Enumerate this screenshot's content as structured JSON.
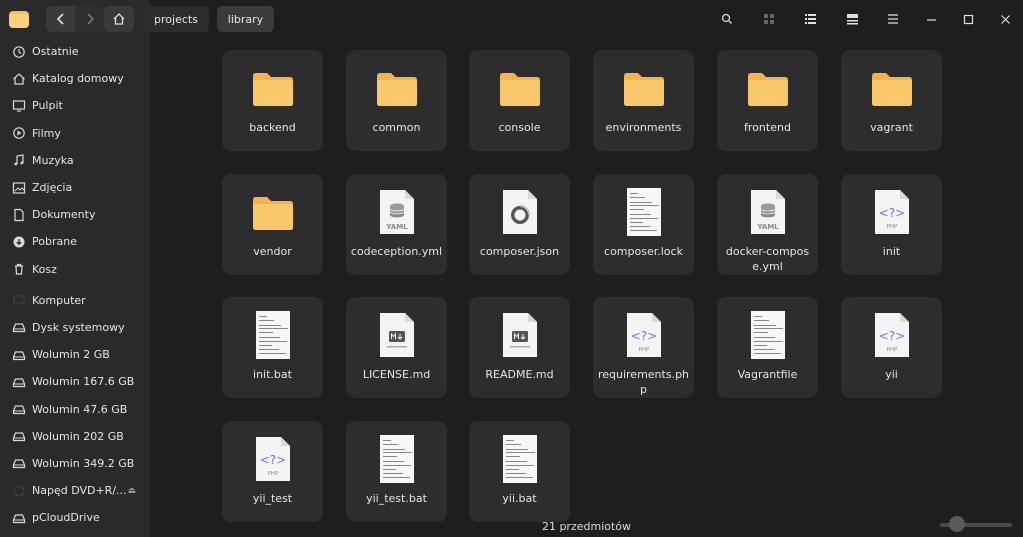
{
  "header": {
    "breadcrumbs": [
      "projects",
      "library"
    ]
  },
  "sidebar": {
    "places": [
      {
        "label": "Ostatnie",
        "icon": "clock-icon"
      },
      {
        "label": "Katalog domowy",
        "icon": "home-icon"
      },
      {
        "label": "Pulpit",
        "icon": "desktop-icon"
      },
      {
        "label": "Filmy",
        "icon": "video-icon"
      },
      {
        "label": "Muzyka",
        "icon": "music-icon"
      },
      {
        "label": "Zdjęcia",
        "icon": "image-icon"
      },
      {
        "label": "Dokumenty",
        "icon": "document-icon"
      },
      {
        "label": "Pobrane",
        "icon": "download-icon"
      },
      {
        "label": "Kosz",
        "icon": "trash-icon"
      }
    ],
    "devices": [
      {
        "label": "Komputer",
        "icon": "computer-icon"
      },
      {
        "label": "Dysk systemowy",
        "icon": "drive-icon"
      },
      {
        "label": "Wolumin 2 GB",
        "icon": "drive-icon"
      },
      {
        "label": "Wolumin 167.6 GB",
        "icon": "drive-icon"
      },
      {
        "label": "Wolumin 47.6 GB",
        "icon": "drive-icon"
      },
      {
        "label": "Wolumin 202 GB",
        "icon": "drive-icon"
      },
      {
        "label": "Wolumin 349.2 GB",
        "icon": "drive-icon"
      },
      {
        "label": "Napęd DVD+R/...",
        "icon": "optical-drive-icon"
      },
      {
        "label": "pCloudDrive",
        "icon": "cloud-drive-icon"
      }
    ]
  },
  "files": [
    {
      "name": "backend",
      "type": "folder"
    },
    {
      "name": "common",
      "type": "folder"
    },
    {
      "name": "console",
      "type": "folder"
    },
    {
      "name": "environments",
      "type": "folder"
    },
    {
      "name": "frontend",
      "type": "folder"
    },
    {
      "name": "vagrant",
      "type": "folder"
    },
    {
      "name": "vendor",
      "type": "folder"
    },
    {
      "name": "codeception.yml",
      "type": "yaml"
    },
    {
      "name": "composer.json",
      "type": "json"
    },
    {
      "name": "composer.lock",
      "type": "text"
    },
    {
      "name": "docker-compose.yml",
      "type": "yaml"
    },
    {
      "name": "init",
      "type": "php"
    },
    {
      "name": "init.bat",
      "type": "text"
    },
    {
      "name": "LICENSE.md",
      "type": "markdown"
    },
    {
      "name": "README.md",
      "type": "markdown"
    },
    {
      "name": "requirements.php",
      "type": "php"
    },
    {
      "name": "Vagrantfile",
      "type": "text"
    },
    {
      "name": "yii",
      "type": "php"
    },
    {
      "name": "yii_test",
      "type": "php"
    },
    {
      "name": "yii_test.bat",
      "type": "text"
    },
    {
      "name": "yii.bat",
      "type": "text"
    }
  ],
  "status": {
    "item_count": "21 przedmiotów"
  },
  "colors": {
    "folder": "#f9c86a",
    "folder_tab": "#f5b443",
    "accent": "#7a6cf0"
  }
}
